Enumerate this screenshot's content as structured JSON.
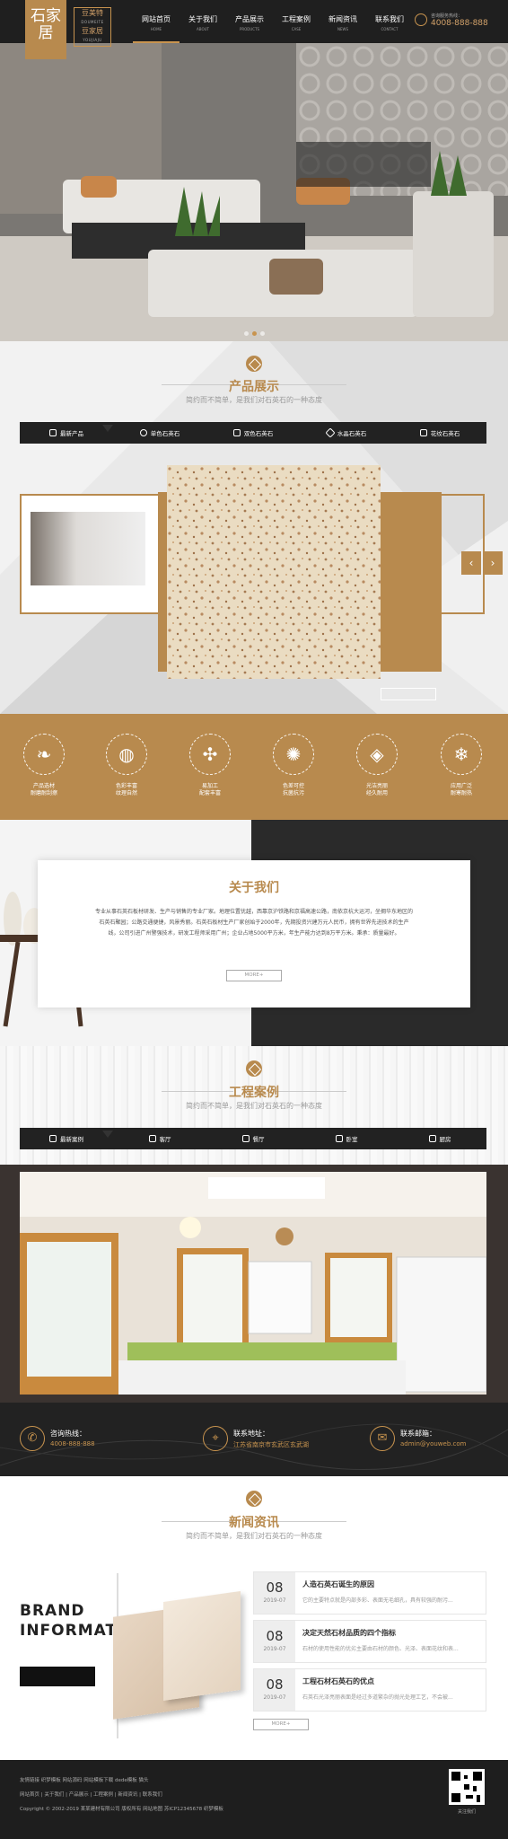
{
  "header": {
    "logo": "石家居",
    "brand_cn": "豆美特",
    "brand_en": "DOUMEITE",
    "brand_cn2": "豆家居",
    "brand_en2": "YOUJIAJU",
    "nav": [
      {
        "label": "网站首页",
        "en": "HOME"
      },
      {
        "label": "关于我们",
        "en": "ABOUT"
      },
      {
        "label": "产品展示",
        "en": "PRODUCTS"
      },
      {
        "label": "工程案例",
        "en": "CASE"
      },
      {
        "label": "新闻资讯",
        "en": "NEWS"
      },
      {
        "label": "联系我们",
        "en": "CONTACT"
      }
    ],
    "hotline_label": "咨询服务热线：",
    "hotline": "4008-888-888"
  },
  "products": {
    "title": "产品展示",
    "subtitle": "简约而不简单，是我们对石英石的一种态度",
    "tabs": [
      "最新产品",
      "单色石英石",
      "双色石英石",
      "水晶石英石",
      "花纹石英石"
    ]
  },
  "features": [
    {
      "line1": "产品选材",
      "line2": "耐磨耐刮擦"
    },
    {
      "line1": "色彩丰富",
      "line2": "纹理自然"
    },
    {
      "line1": "易加工",
      "line2": "配套丰富"
    },
    {
      "line1": "色差可控",
      "line2": "抗菌抗污"
    },
    {
      "line1": "光洁亮丽",
      "line2": "经久耐用"
    },
    {
      "line1": "应用广泛",
      "line2": "耐寒耐热"
    }
  ],
  "about": {
    "title": "关于我们",
    "text": "专业从事石英石板材研发、生产与销售的专业厂家。地理位置优越，西靠京沪铁路和京福高速公路，南依京杭大运河，坐拥华东地区的石英石聚园；公路交通便捷，风景秀丽。石英石板材生产厂家创始于2000年，先期投资兴建万元人民币，拥有世界先进技术的生产线，公司引进广州警强技术，研发工程师采用广州；企业占地5000平方米，年生产能力达到8万平方米。秉承：质量最好。",
    "more": "MORE+"
  },
  "cases": {
    "title": "工程案例",
    "subtitle": "简约而不简单，是我们对石英石的一种态度",
    "tabs": [
      "最新案例",
      "客厅",
      "餐厅",
      "卧室",
      "厨房"
    ]
  },
  "contact": [
    {
      "label": "咨询热线：",
      "value": "4008-888-888"
    },
    {
      "label": "联系地址：",
      "value": "江苏省南京市玄武区玄武湖"
    },
    {
      "label": "联系邮箱：",
      "value": "admin@youweb.com"
    }
  ],
  "news": {
    "title": "新闻资讯",
    "subtitle": "简约而不简单，是我们对石英石的一种态度",
    "banner_line1": "BRAND",
    "banner_line2": "INFORMATION",
    "items": [
      {
        "day": "08",
        "ym": "2019-07",
        "title": "人造石英石诞生的原因",
        "desc": "它的主要特点就是内部多彩、表面无毛细孔，具有较强的耐污..."
      },
      {
        "day": "08",
        "ym": "2019-07",
        "title": "决定天然石材品质的四个指标",
        "desc": "石材的使用性能的优劣主要由石材的颜色、光泽、表面花纹和表..."
      },
      {
        "day": "08",
        "ym": "2019-07",
        "title": "工程石材石英石的优点",
        "desc": "石英石光泽亮丽表面是经过多道繁杂的抛光处理工艺，不会被..."
      }
    ],
    "more": "MORE+"
  },
  "footer": {
    "links1": "友情链接  织梦模板  网站源码  网站模板下载  dede模板  猫头",
    "links2": "网站首页  |  关于我们  |  产品展示  |  工程案例  |  新闻资讯  |  联系我们",
    "copyright": "Copyright © 2002-2019 某某建材有限公司 版权所有  网站地图  苏ICP12345678  织梦模板",
    "qr_caption": "关注我们"
  },
  "colors": {
    "accent": "#b88a4e",
    "dark": "#222222"
  }
}
